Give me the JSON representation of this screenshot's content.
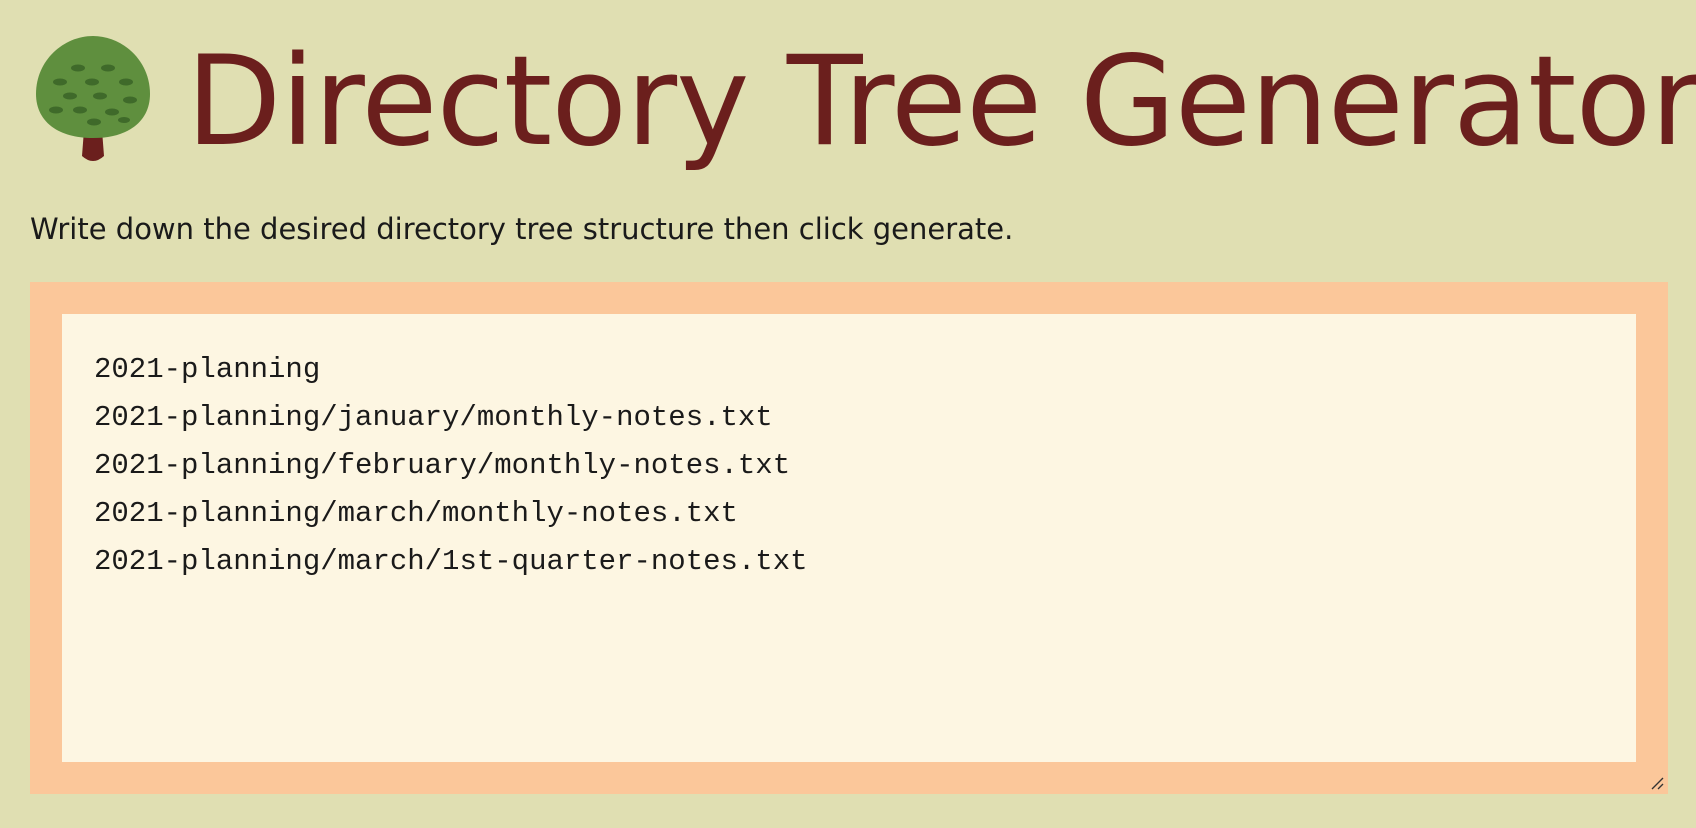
{
  "header": {
    "icon": "tree-icon",
    "title": "Directory Tree Generator"
  },
  "instructions": "Write down the desired directory tree structure then click generate.",
  "editor": {
    "value": "2021-planning\n2021-planning/january/monthly-notes.txt\n2021-planning/february/monthly-notes.txt\n2021-planning/march/monthly-notes.txt\n2021-planning/march/1st-quarter-notes.txt"
  },
  "colors": {
    "background": "#e0dfb2",
    "title": "#6b1f1d",
    "frame": "#fbc79a",
    "editor_background": "#fdf6e2",
    "tree_foliage": "#5f8f3e",
    "tree_trunk": "#6b1f1d"
  }
}
